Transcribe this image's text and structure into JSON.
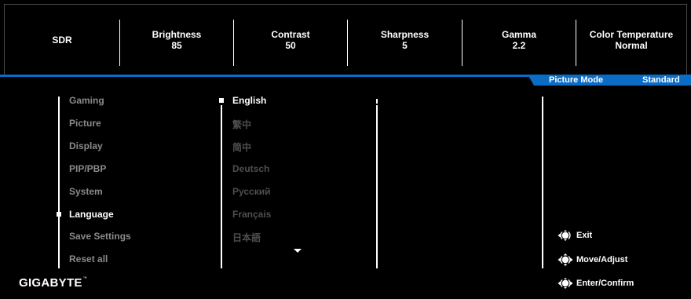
{
  "header": {
    "items": [
      {
        "label": "SDR",
        "value": ""
      },
      {
        "label": "Brightness",
        "value": "85"
      },
      {
        "label": "Contrast",
        "value": "50"
      },
      {
        "label": "Sharpness",
        "value": "5"
      },
      {
        "label": "Gamma",
        "value": "2.2"
      },
      {
        "label": "Color Temperature",
        "value": "Normal"
      }
    ]
  },
  "picture_mode": {
    "label": "Picture Mode",
    "value": "Standard"
  },
  "menu": {
    "items": [
      "Gaming",
      "Picture",
      "Display",
      "PIP/PBP",
      "System",
      "Language",
      "Save Settings",
      "Reset all"
    ],
    "active": "Language"
  },
  "languages": {
    "items": [
      "English",
      "繁中",
      "简中",
      "Deutsch",
      "Русский",
      "Français",
      "日本語"
    ],
    "selected": "English"
  },
  "brand": {
    "logo": "GIGABYTE",
    "trademark": "™"
  },
  "guide": {
    "items": [
      {
        "icon": "joystick-left-icon",
        "label": "Exit"
      },
      {
        "icon": "joystick-all-directions-icon",
        "label": "Move/Adjust"
      },
      {
        "icon": "joystick-press-icon",
        "label": "Enter/Confirm"
      }
    ]
  },
  "colors": {
    "accent": "#0a6cc5",
    "background": "#000000",
    "text": "#ffffff",
    "inactive_text": "#8a8a8a",
    "disabled_text": "#4e4e4e"
  }
}
